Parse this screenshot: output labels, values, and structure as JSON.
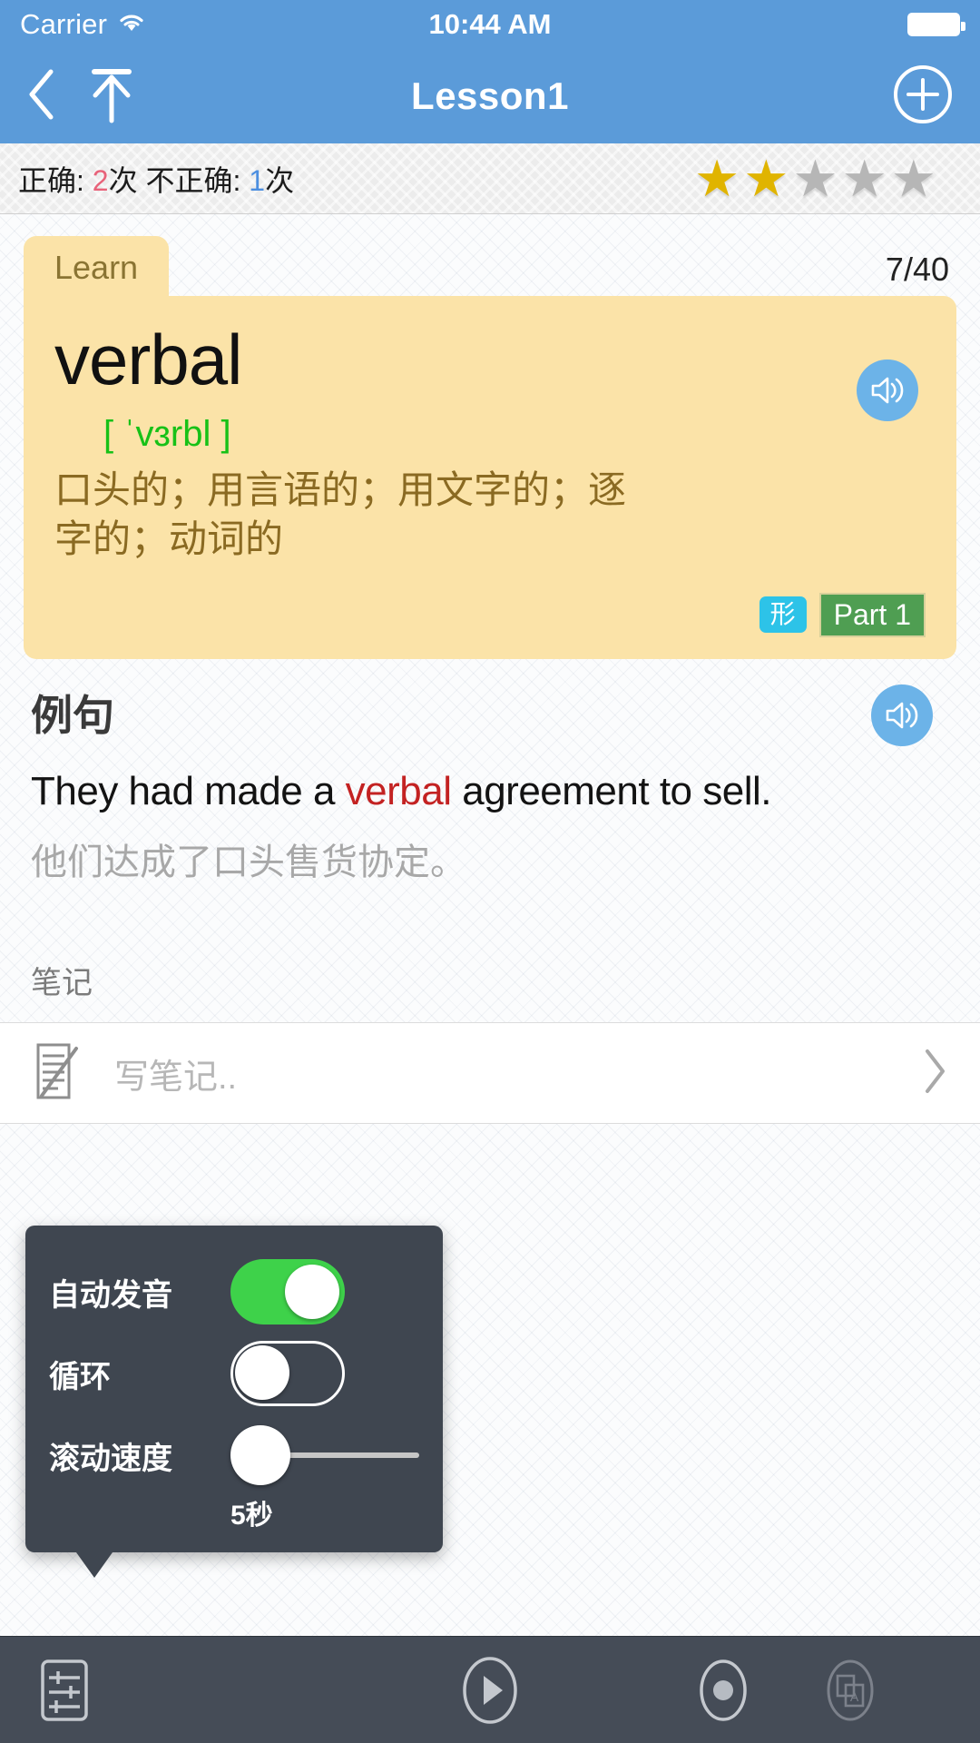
{
  "status_bar": {
    "carrier": "Carrier",
    "wifi_icon": "wifi-icon",
    "time": "10:44 AM",
    "battery_icon": "battery-full-icon"
  },
  "nav_bar": {
    "back_icon": "chevron-left-icon",
    "up_icon": "arrow-up-icon",
    "title": "Lesson1",
    "add_icon": "plus-circle-icon"
  },
  "stats_bar": {
    "correct_label": "正确: ",
    "correct_count": "2",
    "correct_unit": "次",
    "incorrect_label": " 不正确: ",
    "incorrect_count": "1",
    "incorrect_unit": "次",
    "stars_filled": 2,
    "stars_total": 5,
    "star_glyph": "★",
    "star_on_color": "#e0b400",
    "star_off_color": "#b6b6b6"
  },
  "card": {
    "tab_label": "Learn",
    "counter": "7/40",
    "word": "verbal",
    "phonetic": "[ ˈvɜrbl ]",
    "meaning": "口头的；用言语的；用文字的；逐字的；动词的",
    "speaker_icon": "speaker-icon",
    "badge_pos": "形",
    "badge_part": "Part 1",
    "badge_pos_color": "#2dc3e8",
    "badge_part_color": "#4f9e52"
  },
  "example": {
    "heading": "例句",
    "speaker_icon": "speaker-icon",
    "sentence_pre": "They had made a ",
    "sentence_highlight": "verbal",
    "sentence_post": " agreement to sell.",
    "highlight_color": "#c32222",
    "translation": "他们达成了口头售货协定。"
  },
  "notes": {
    "label": "笔记",
    "note_icon": "note-edit-icon",
    "placeholder": "写笔记..",
    "chevron_icon": "chevron-right-icon"
  },
  "settings_popup": {
    "rows": [
      {
        "label": "自动发音",
        "control": "switch",
        "state": "on"
      },
      {
        "label": "循环",
        "control": "switch",
        "state": "off"
      },
      {
        "label": "滚动速度",
        "control": "slider",
        "value": "5秒"
      }
    ],
    "slider_value_label": "5秒",
    "switch_on_color": "#3ed24a",
    "background": "#3f4650"
  },
  "toolbar": {
    "settings_icon": "sliders-icon",
    "play_icon": "play-circle-icon",
    "record_icon": "record-circle-icon",
    "translate_icon": "translate-icon",
    "background": "#454c57"
  }
}
